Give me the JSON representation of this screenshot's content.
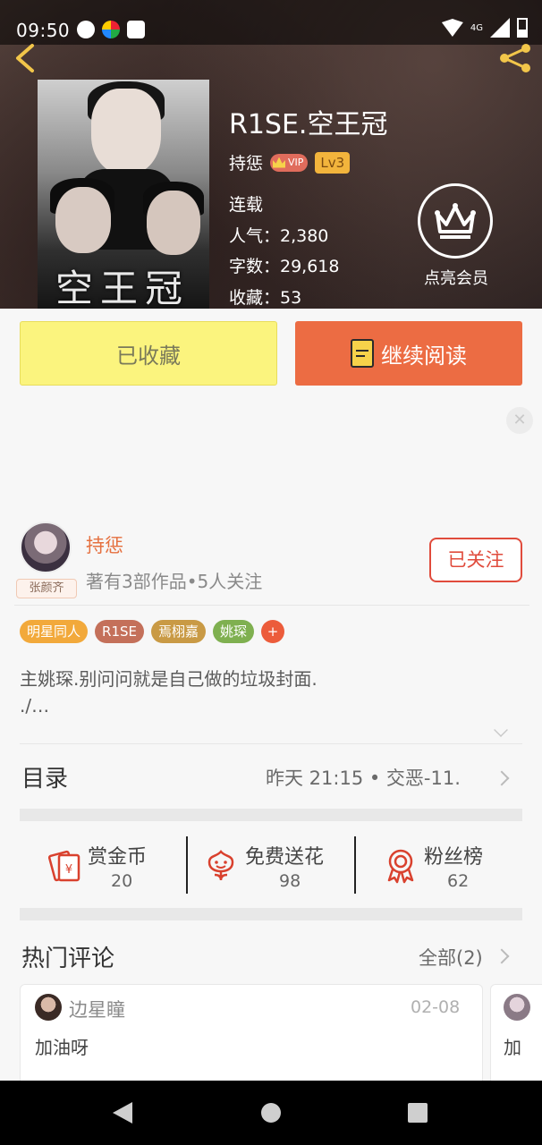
{
  "status_bar": {
    "time": "09:50",
    "network": "4G"
  },
  "book": {
    "title": "R1SE.空王冠",
    "cover_text": "空王冠",
    "author": "持惩",
    "vip": "VIP",
    "level": "Lv3",
    "status": "连载",
    "popularity": "人气：2,380",
    "word_count": "字数：29,618",
    "favorites": "收藏：53"
  },
  "member": {
    "label": "点亮会员"
  },
  "actions": {
    "saved": "已收藏",
    "continue_reading": "继续阅读"
  },
  "ad": {
    "close": "✕"
  },
  "author_card": {
    "name": "持惩",
    "avatar_tag": "张颜齐",
    "stats": "著有3部作品•5人关注",
    "follow": "已关注"
  },
  "tags": [
    {
      "label": "明星同人",
      "color": "#f2a93b"
    },
    {
      "label": "R1SE",
      "color": "#c4705a"
    },
    {
      "label": "焉栩嘉",
      "color": "#c99a45"
    },
    {
      "label": "姚琛",
      "color": "#7fb050"
    },
    {
      "label": "+",
      "color": "#ec5c3b"
    }
  ],
  "description": {
    "line1": "主姚琛.别问问就是自己做的垃圾封面.",
    "line2": "./…"
  },
  "toc": {
    "title": "目录",
    "latest": "昨天 21:15 • 交恶-11."
  },
  "stats": [
    {
      "label": "赏金币",
      "value": "20"
    },
    {
      "label": "免费送花",
      "value": "98"
    },
    {
      "label": "粉丝榜",
      "value": "62"
    }
  ],
  "comments": {
    "title": "热门评论",
    "all": "全部(2)",
    "items": [
      {
        "user": "边星瞳",
        "date": "02-08",
        "text": "加油呀"
      },
      {
        "text": "加"
      }
    ]
  }
}
